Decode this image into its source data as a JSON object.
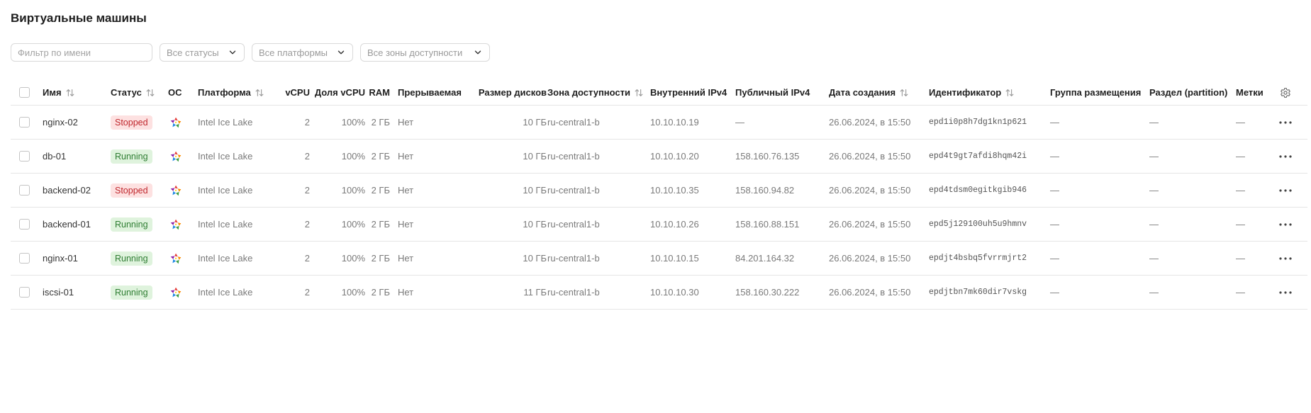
{
  "page": {
    "title": "Виртуальные машины"
  },
  "filters": {
    "name_placeholder": "Фильтр по имени",
    "status_select": "Все статусы",
    "platform_select": "Все платформы",
    "zone_select": "Все зоны доступности"
  },
  "table": {
    "columns": {
      "name": "Имя",
      "status": "Статус",
      "os": "ОС",
      "platform": "Платформа",
      "vcpu": "vCPU",
      "vcpu_share": "Доля vCPU",
      "ram": "RAM",
      "preemptible": "Прерываемая",
      "disk_size": "Размер дисков",
      "zone": "Зона доступности",
      "internal_ip": "Внутренний IPv4",
      "public_ip": "Публичный IPv4",
      "created": "Дата создания",
      "id": "Идентификатор",
      "placement_group": "Группа размещения",
      "partition": "Раздел (partition)",
      "labels": "Метки"
    },
    "status_colors": {
      "Stopped": "#c0272d",
      "Running": "#2e7d32"
    },
    "os_icon": "linux-os-icon",
    "rows": [
      {
        "name": "nginx-02",
        "status": "Stopped",
        "status_key": "stopped",
        "platform": "Intel Ice Lake",
        "vcpu": "2",
        "vcpu_share": "100%",
        "ram": "2 ГБ",
        "preemptible": "Нет",
        "disk_size": "10 ГБ",
        "zone": "ru-central1-b",
        "internal_ip": "10.10.10.19",
        "public_ip": "—",
        "created": "26.06.2024, в 15:50",
        "id": "epd1i0p8h7dg1kn1p621",
        "placement_group": "—",
        "partition": "—",
        "labels": "—"
      },
      {
        "name": "db-01",
        "status": "Running",
        "status_key": "running",
        "platform": "Intel Ice Lake",
        "vcpu": "2",
        "vcpu_share": "100%",
        "ram": "2 ГБ",
        "preemptible": "Нет",
        "disk_size": "10 ГБ",
        "zone": "ru-central1-b",
        "internal_ip": "10.10.10.20",
        "public_ip": "158.160.76.135",
        "created": "26.06.2024, в 15:50",
        "id": "epd4t9gt7afdi8hqm42i",
        "placement_group": "—",
        "partition": "—",
        "labels": "—"
      },
      {
        "name": "backend-02",
        "status": "Stopped",
        "status_key": "stopped",
        "platform": "Intel Ice Lake",
        "vcpu": "2",
        "vcpu_share": "100%",
        "ram": "2 ГБ",
        "preemptible": "Нет",
        "disk_size": "10 ГБ",
        "zone": "ru-central1-b",
        "internal_ip": "10.10.10.35",
        "public_ip": "158.160.94.82",
        "created": "26.06.2024, в 15:50",
        "id": "epd4tdsm0egitkgib946",
        "placement_group": "—",
        "partition": "—",
        "labels": "—"
      },
      {
        "name": "backend-01",
        "status": "Running",
        "status_key": "running",
        "platform": "Intel Ice Lake",
        "vcpu": "2",
        "vcpu_share": "100%",
        "ram": "2 ГБ",
        "preemptible": "Нет",
        "disk_size": "10 ГБ",
        "zone": "ru-central1-b",
        "internal_ip": "10.10.10.26",
        "public_ip": "158.160.88.151",
        "created": "26.06.2024, в 15:50",
        "id": "epd5j129100uh5u9hmnv",
        "placement_group": "—",
        "partition": "—",
        "labels": "—"
      },
      {
        "name": "nginx-01",
        "status": "Running",
        "status_key": "running",
        "platform": "Intel Ice Lake",
        "vcpu": "2",
        "vcpu_share": "100%",
        "ram": "2 ГБ",
        "preemptible": "Нет",
        "disk_size": "10 ГБ",
        "zone": "ru-central1-b",
        "internal_ip": "10.10.10.15",
        "public_ip": "84.201.164.32",
        "created": "26.06.2024, в 15:50",
        "id": "epdjt4bsbq5fvrrmjrt2",
        "placement_group": "—",
        "partition": "—",
        "labels": "—"
      },
      {
        "name": "iscsi-01",
        "status": "Running",
        "status_key": "running",
        "platform": "Intel Ice Lake",
        "vcpu": "2",
        "vcpu_share": "100%",
        "ram": "2 ГБ",
        "preemptible": "Нет",
        "disk_size": "11 ГБ",
        "zone": "ru-central1-b",
        "internal_ip": "10.10.10.30",
        "public_ip": "158.160.30.222",
        "created": "26.06.2024, в 15:50",
        "id": "epdjtbn7mk60dir7vskg",
        "placement_group": "—",
        "partition": "—",
        "labels": "—"
      }
    ]
  }
}
